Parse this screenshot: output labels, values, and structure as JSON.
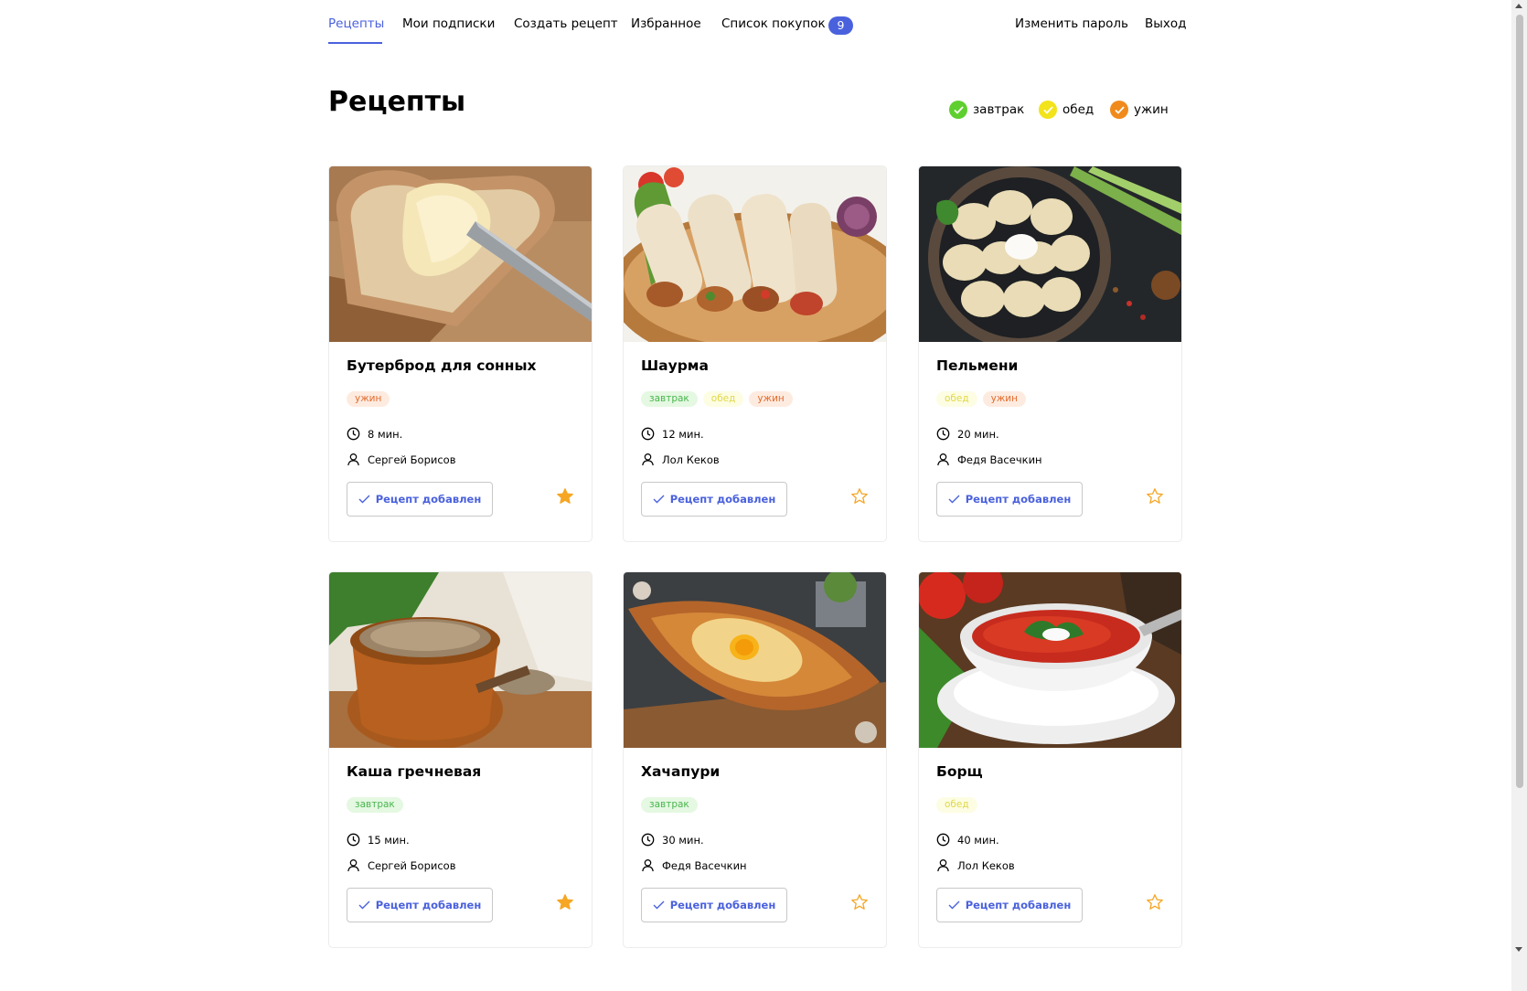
{
  "nav": {
    "links": [
      "Рецепты",
      "Мои подписки",
      "Создать рецепт",
      "Избранное",
      "Список покупок"
    ],
    "cart_count": "9",
    "change_password": "Изменить пароль",
    "logout": "Выход"
  },
  "page": {
    "title": "Рецепты"
  },
  "legend": [
    {
      "label": "завтрак",
      "color": "#5fcf2f"
    },
    {
      "label": "обед",
      "color": "#f2e31a"
    },
    {
      "label": "ужин",
      "color": "#f08a1c"
    }
  ],
  "recipes": [
    {
      "title": "Бутерброд для сонных",
      "tags": [
        "ужин"
      ],
      "time": "8 мин.",
      "author": "Сергей Борисов",
      "button": "Рецепт добавлен",
      "favorite": true,
      "image": "bread-with-butter"
    },
    {
      "title": "Шаурма",
      "tags": [
        "завтрак",
        "обед",
        "ужин"
      ],
      "time": "12 мин.",
      "author": "Лол Кеков",
      "button": "Рецепт добавлен",
      "favorite": false,
      "image": "shawarma"
    },
    {
      "title": "Пельмени",
      "tags": [
        "обед",
        "ужин"
      ],
      "time": "20 мин.",
      "author": "Федя Васечкин",
      "button": "Рецепт добавлен",
      "favorite": false,
      "image": "pelmeni"
    },
    {
      "title": "Каша гречневая",
      "tags": [
        "завтрак"
      ],
      "time": "15 мин.",
      "author": "Сергей Борисов",
      "button": "Рецепт добавлен",
      "favorite": true,
      "image": "buckwheat"
    },
    {
      "title": "Хачапури",
      "tags": [
        "завтрак"
      ],
      "time": "30 мин.",
      "author": "Федя Васечкин",
      "button": "Рецепт добавлен",
      "favorite": false,
      "image": "khachapuri"
    },
    {
      "title": "Борщ",
      "tags": [
        "обед"
      ],
      "time": "40 мин.",
      "author": "Лол Кеков",
      "button": "Рецепт добавлен",
      "favorite": false,
      "image": "borscht"
    }
  ],
  "colors": {
    "accent": "#4a61dd",
    "star": "#f5a623"
  }
}
